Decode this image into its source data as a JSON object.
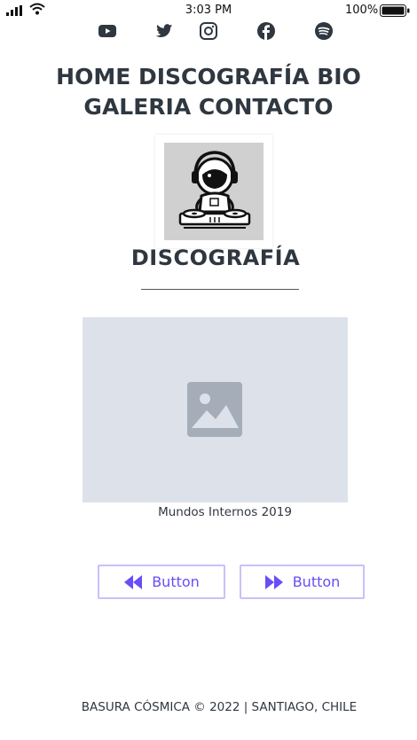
{
  "status_bar": {
    "time": "3:03 PM",
    "battery": "100%"
  },
  "social": [
    "youtube-icon",
    "twitter-icon",
    "instagram-icon",
    "facebook-icon",
    "spotify-icon"
  ],
  "nav": {
    "home": "HOME",
    "discografia": "DISCOGRAFÍA",
    "bio": "BIO",
    "galeria": "GALERIA",
    "contacto": "CONTACTO"
  },
  "section_title": "DISCOGRAFÍA",
  "album": {
    "caption": "Mundos Internos 2019"
  },
  "buttons": {
    "prev_label": "Button",
    "next_label": "Button"
  },
  "footer": {
    "text": "BASURA CÓSMICA  ©  2022 | SANTIAGO, CHILE"
  },
  "colors": {
    "text": "#2f3740",
    "accent": "#6a4df5",
    "button_border": "#c9c0fb",
    "placeholder_bg": "#dde2ea",
    "placeholder_icon": "#a4adb8"
  }
}
